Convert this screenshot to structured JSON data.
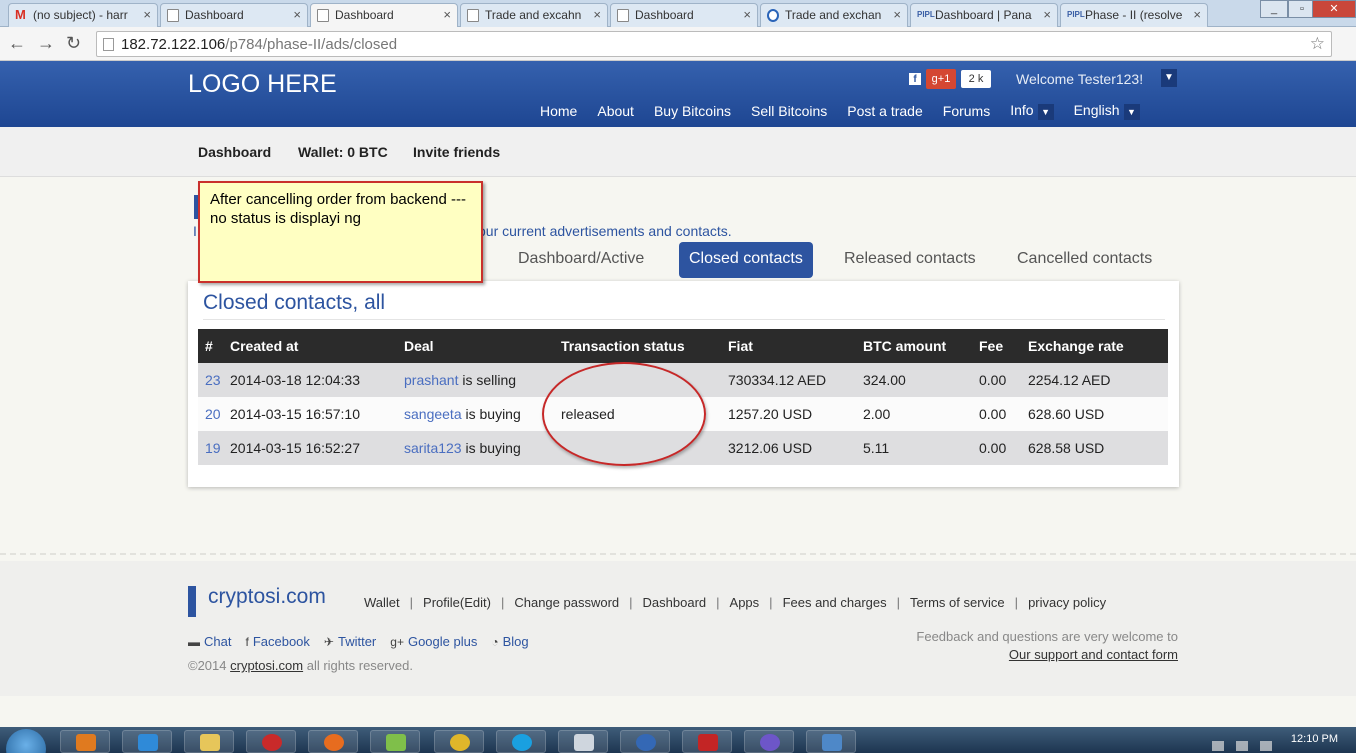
{
  "browser": {
    "tabs": [
      {
        "label": "(no subject) - harr",
        "icon": "gmail-icon"
      },
      {
        "label": "Dashboard",
        "icon": "page-icon"
      },
      {
        "label": "Dashboard",
        "icon": "page-icon",
        "active": true
      },
      {
        "label": "Trade and excahn",
        "icon": "page-icon"
      },
      {
        "label": "Dashboard",
        "icon": "page-icon"
      },
      {
        "label": "Trade and exchan",
        "icon": "circle-icon"
      },
      {
        "label": "Dashboard | Pana",
        "icon": "pipl-icon"
      },
      {
        "label": "Phase - II (resolve",
        "icon": "pipl-icon"
      }
    ],
    "url_host": "182.72.122.106",
    "url_path": "/p784/phase-II/ads/closed"
  },
  "header": {
    "logo": "LOGO HERE",
    "gplus_label": "g+1",
    "gplus_count": "2 k",
    "welcome": "Welcome Tester123!",
    "nav": [
      "Home",
      "About",
      "Buy Bitcoins",
      "Sell Bitcoins",
      "Post a trade",
      "Forums",
      "Info",
      "English"
    ]
  },
  "subnav": {
    "dashboard": "Dashboard",
    "wallet": "Wallet: 0 BTC",
    "invite": "Invite friends"
  },
  "intro": {
    "letter": "I",
    "text": "our current advertisements and contacts."
  },
  "contact_tabs": [
    "Dashboard/Active",
    "Closed contacts",
    "Released contacts",
    "Cancelled contacts"
  ],
  "panel": {
    "title": "Closed contacts, all",
    "columns": [
      "#",
      "Created at",
      "Deal",
      "Transaction status",
      "Fiat",
      "BTC amount",
      "Fee",
      "Exchange rate"
    ],
    "rows": [
      {
        "id": "23",
        "created": "2014-03-18 12:04:33",
        "user": "prashant",
        "action": "is selling",
        "status": "",
        "fiat": "730334.12 AED",
        "btc": "324.00",
        "fee": "0.00",
        "rate": "2254.12 AED"
      },
      {
        "id": "20",
        "created": "2014-03-15 16:57:10",
        "user": "sangeeta",
        "action": "is buying",
        "status": "released",
        "fiat": "1257.20 USD",
        "btc": "2.00",
        "fee": "0.00",
        "rate": "628.60 USD"
      },
      {
        "id": "19",
        "created": "2014-03-15 16:52:27",
        "user": "sarita123",
        "action": "is buying",
        "status": "",
        "fiat": "3212.06 USD",
        "btc": "5.11",
        "fee": "0.00",
        "rate": "628.58 USD"
      }
    ]
  },
  "annotation": {
    "note": "After cancelling order from backend ---no status is displayi ng"
  },
  "footer": {
    "brand": "cryptosi.com",
    "links": [
      "Wallet",
      "Profile(Edit)",
      "Change password",
      "Dashboard",
      "Apps",
      "Fees and charges",
      "Terms of service",
      "privacy policy"
    ],
    "social": [
      {
        "label": "Chat",
        "icon": "chat-icon"
      },
      {
        "label": "Facebook",
        "icon": "facebook-icon"
      },
      {
        "label": "Twitter",
        "icon": "twitter-icon"
      },
      {
        "label": "Google plus",
        "icon": "google-plus-icon"
      },
      {
        "label": "Blog",
        "icon": "blog-icon"
      }
    ],
    "copyright_prefix": "©2014",
    "copyright_link": "cryptosi.com",
    "copyright_suffix": "all rights reserved.",
    "feedback_text": "Feedback and questions are very welcome to",
    "feedback_link": "Our support and contact form"
  },
  "taskbar": {
    "clock": "12:10 PM"
  },
  "colors": {
    "brand_blue": "#2d54a0",
    "header_gradient_top": "#3561ae",
    "annotation_red": "#c62828",
    "note_yellow": "#ffffc2"
  }
}
